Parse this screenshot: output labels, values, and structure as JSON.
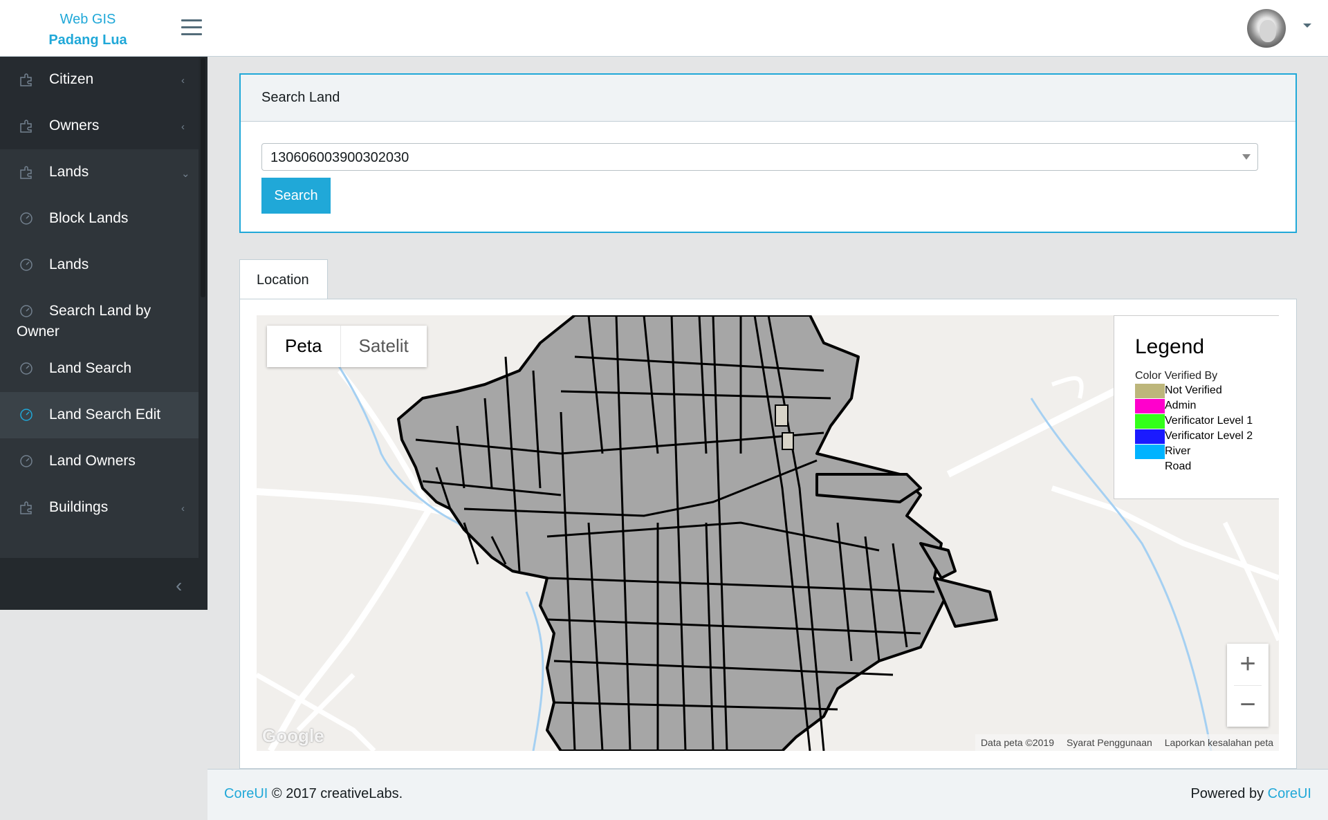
{
  "brand": {
    "line1": "Web GIS",
    "line2": "Padang Lua"
  },
  "sidebar": {
    "items": [
      {
        "label": "Citizen",
        "icon": "puzzle-icon",
        "chevron": "‹"
      },
      {
        "label": "Owners",
        "icon": "puzzle-icon",
        "chevron": "‹"
      },
      {
        "label": "Lands",
        "icon": "puzzle-icon",
        "chevron": "⌄"
      },
      {
        "label": "Block Lands",
        "icon": "speedometer-icon"
      },
      {
        "label": "Lands",
        "icon": "speedometer-icon"
      },
      {
        "label": "Search Land by",
        "label2": "Owner",
        "icon": "speedometer-icon"
      },
      {
        "label": "Land Search",
        "icon": "speedometer-icon"
      },
      {
        "label": "Land Search Edit",
        "icon": "speedometer-icon"
      },
      {
        "label": "Land Owners",
        "icon": "speedometer-icon"
      },
      {
        "label": "Buildings",
        "icon": "puzzle-icon",
        "chevron": "‹"
      }
    ],
    "minimizer": "‹"
  },
  "search_card": {
    "title": "Search Land",
    "selected_value": "130606003900302030",
    "button_label": "Search"
  },
  "tabs": [
    {
      "label": "Location"
    }
  ],
  "map": {
    "type_controls": {
      "map": "Peta",
      "satellite": "Satelit"
    },
    "legend": {
      "title": "Legend",
      "subtitle": "Color Verified By",
      "entries": [
        {
          "label": "Not Verified",
          "color": "#bdb67b"
        },
        {
          "label": "Admin",
          "color": "#ff00cc"
        },
        {
          "label": "Verificator Level 1",
          "color": "#33ff1a"
        },
        {
          "label": "Verificator Level 2",
          "color": "#1a1aff"
        },
        {
          "label": "River",
          "color": "#00b3ff"
        },
        {
          "label": "Road",
          "color": "#ffffff"
        }
      ]
    },
    "zoom_in": "+",
    "zoom_out": "−",
    "google_logo": "Google",
    "attribution": {
      "data": "Data peta ©2019",
      "terms": "Syarat Penggunaan",
      "report": "Laporkan kesalahan peta"
    },
    "parcel_fill": "#a6a6a6",
    "parcel_stroke": "#000000"
  },
  "footer": {
    "left_link": "CoreUI",
    "left_text": "© 2017 creativeLabs.",
    "right_text": "Powered by",
    "right_link": "CoreUI"
  },
  "colors": {
    "accent": "#20a8d8",
    "sidebar": "#2f353a"
  }
}
